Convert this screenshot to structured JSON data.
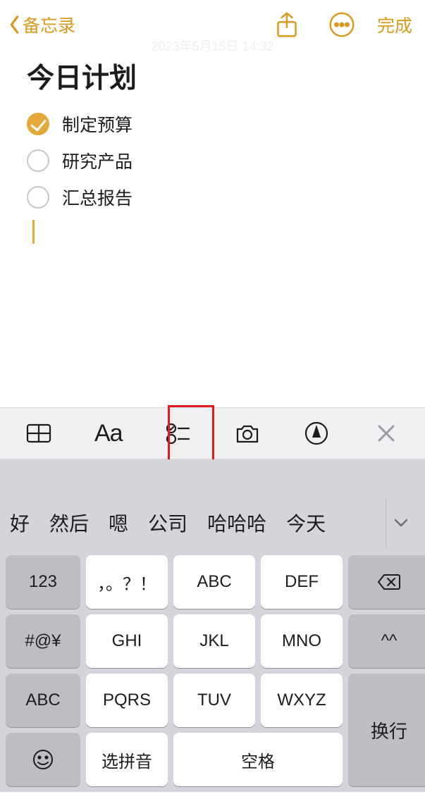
{
  "header": {
    "back_label": "备忘录",
    "done_label": "完成"
  },
  "timestamp": "2023年5月15日 14:32",
  "note": {
    "title": "今日计划",
    "items": [
      {
        "label": "制定预算",
        "checked": true
      },
      {
        "label": "研究产品",
        "checked": false
      },
      {
        "label": "汇总报告",
        "checked": false
      }
    ]
  },
  "toolbar": {
    "aa_label": "Aa"
  },
  "candidates": [
    "好",
    "然后",
    "嗯",
    "公司",
    "哈哈哈",
    "今天"
  ],
  "keyboard": {
    "k123": "123",
    "punct": "，。？！",
    "abc": "ABC",
    "def": "DEF",
    "sym": "#@¥",
    "ghi": "GHI",
    "jkl": "JKL",
    "mno": "MNO",
    "face": "^^",
    "abc2": "ABC",
    "pqrs": "PQRS",
    "tuv": "TUV",
    "wxyz": "WXYZ",
    "return": "换行",
    "emoji": "☺",
    "pinyin": "选拼音",
    "space": "空格"
  }
}
